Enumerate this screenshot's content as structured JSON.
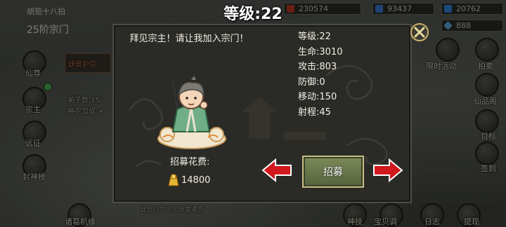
{
  "background": {
    "player_name": "胡笳十八拍",
    "sect_rank": "25阶宗门",
    "resources": [
      {
        "value": "230574",
        "icon": "red-gem-icon",
        "color": "#c0392b"
      },
      {
        "value": "93437",
        "icon": "blue-crystal-icon",
        "color": "#3a7bd5"
      },
      {
        "value": "20762",
        "icon": "blue-gem-icon",
        "color": "#2e86de"
      },
      {
        "value": "888",
        "icon": "diamond-icon",
        "color": "#5dade2"
      }
    ],
    "left_buttons": [
      "仙尊",
      "宗主",
      "远征",
      "封神榜"
    ],
    "right_buttons": [
      "限时活动",
      "拍卖",
      "仙品阁",
      "目标",
      "签到"
    ],
    "bottom_buttons": [
      "诸葛机缘",
      "神技",
      "宝贝调",
      "日志",
      "提现"
    ],
    "panel_text": "弟子数:15/",
    "panel_text2": "神农加成:+",
    "panel_label": "妖兽护宗",
    "tip": "此处已为宗门玩家通告"
  },
  "title": "等级:22",
  "dialog": {
    "greeting": "拜见宗主！请让我加入宗门！",
    "stats": [
      {
        "label": "等级",
        "value": "22"
      },
      {
        "label": "生命",
        "value": "3010"
      },
      {
        "label": "攻击",
        "value": "803"
      },
      {
        "label": "防御",
        "value": "0"
      },
      {
        "label": "移动",
        "value": "150"
      },
      {
        "label": "射程",
        "value": "45"
      }
    ],
    "cost_label": "招募花费:",
    "cost_value": "14800",
    "cost_icon": "gold-ingot-icon",
    "recruit_label": "招募",
    "prev_icon": "red-arrow-left-icon",
    "next_icon": "red-arrow-right-icon",
    "close_icon": "close-x-icon"
  },
  "colors": {
    "arrow_red": "#d0181d",
    "button_green": "#6a7848",
    "gold_border": "#c9b26a"
  }
}
